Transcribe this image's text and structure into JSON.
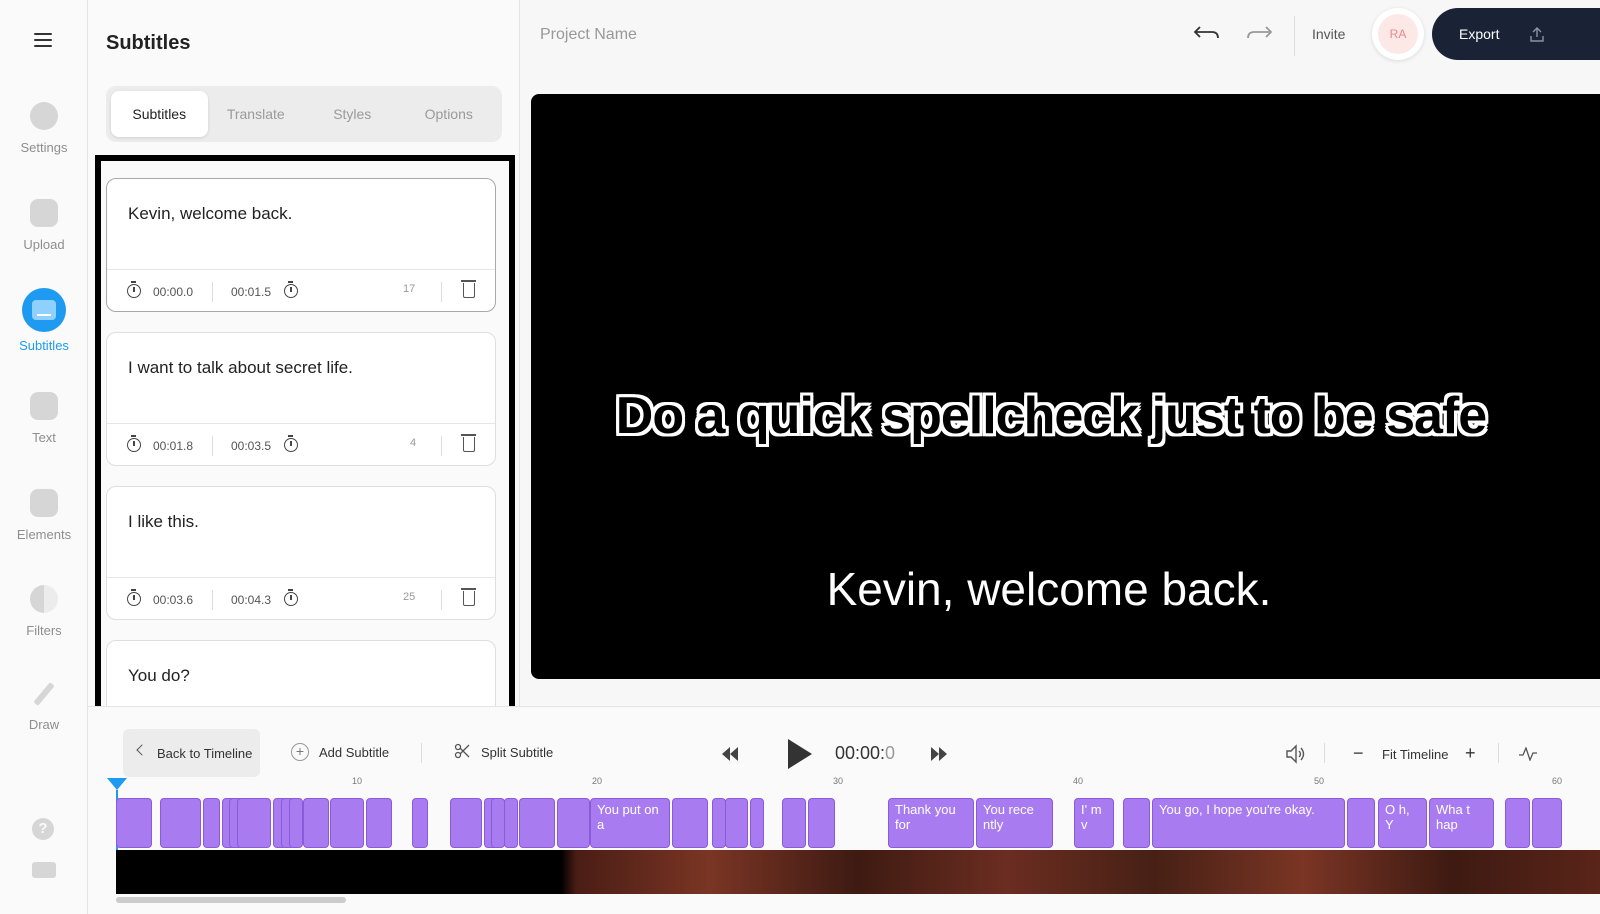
{
  "rail": {
    "items": [
      {
        "label": "Settings",
        "icon": "settings-icon"
      },
      {
        "label": "Upload",
        "icon": "image-upload-icon"
      },
      {
        "label": "Subtitles",
        "icon": "subtitles-icon",
        "active": true
      },
      {
        "label": "Text",
        "icon": "text-icon"
      },
      {
        "label": "Elements",
        "icon": "elements-icon"
      },
      {
        "label": "Filters",
        "icon": "filters-icon"
      },
      {
        "label": "Draw",
        "icon": "pencil-icon"
      }
    ],
    "help_label": "?"
  },
  "panel": {
    "title": "Subtitles",
    "tabs": [
      "Subtitles",
      "Translate",
      "Styles",
      "Options"
    ],
    "active_tab": "Subtitles",
    "cards": [
      {
        "text": "Kevin, welcome back.",
        "start": "00:00.0",
        "end": "00:01.5",
        "count": "17"
      },
      {
        "text": "I want to talk about secret life.",
        "start": "00:01.8",
        "end": "00:03.5",
        "count": "4"
      },
      {
        "text": "I like this.",
        "start": "00:03.6",
        "end": "00:04.3",
        "count": "25"
      },
      {
        "text": "You do?",
        "start": "",
        "end": "",
        "count": ""
      }
    ]
  },
  "topbar": {
    "project_name": "Project Name",
    "invite": "Invite",
    "avatar_initials": "RA",
    "export": "Export"
  },
  "preview": {
    "overlay_caption": "Do a quick spellcheck just to be safe",
    "video_subtitle": "Kevin, welcome back."
  },
  "controls": {
    "back": "Back to Timeline",
    "add": "Add Subtitle",
    "split": "Split Subtitle",
    "timecode_main": "00:00:",
    "timecode_frac": "0",
    "fit": "Fit Timeline",
    "minus": "−",
    "plus": "+",
    "add_plus": "+"
  },
  "timeline": {
    "ruler": [
      "10",
      "20",
      "30",
      "40",
      "50",
      "60"
    ],
    "segments": [
      {
        "text": ""
      },
      {
        "text": ""
      },
      {
        "text": ""
      },
      {
        "text": ""
      },
      {
        "text": ""
      },
      {
        "text": ""
      },
      {
        "text": ""
      },
      {
        "text": ""
      },
      {
        "text": ""
      },
      {
        "text": ""
      },
      {
        "text": ""
      },
      {
        "text": ""
      },
      {
        "text": ""
      },
      {
        "text": ""
      },
      {
        "text": ""
      },
      {
        "text": ""
      },
      {
        "text": ""
      },
      {
        "text": "You put on a"
      },
      {
        "text": ""
      },
      {
        "text": ""
      },
      {
        "text": ""
      },
      {
        "text": ""
      },
      {
        "text": ""
      },
      {
        "text": ""
      },
      {
        "text": "Thank you for"
      },
      {
        "text": "You rece ntly"
      },
      {
        "text": "I' m v"
      },
      {
        "text": ""
      },
      {
        "text": "You go, I hope you're okay."
      },
      {
        "text": ""
      },
      {
        "text": "O h, Y"
      },
      {
        "text": "Wha t hap"
      },
      {
        "text": ""
      },
      {
        "text": ""
      }
    ]
  }
}
